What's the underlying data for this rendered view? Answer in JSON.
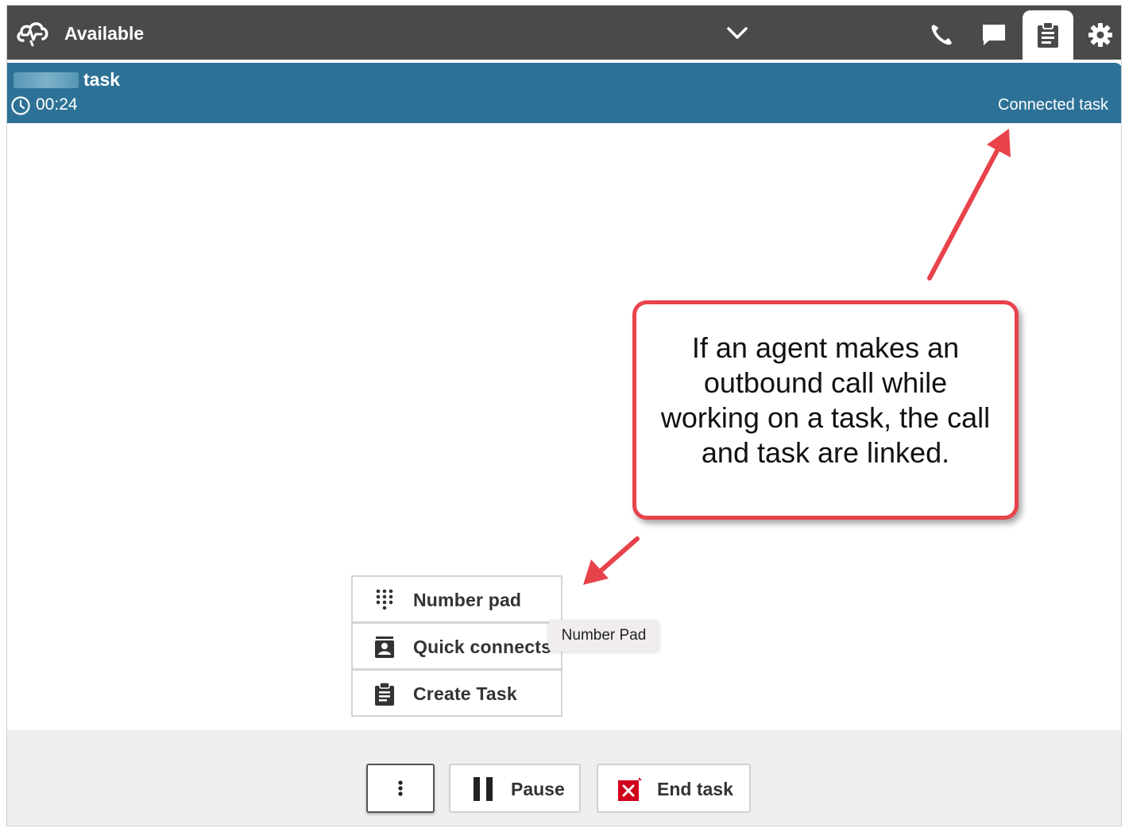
{
  "header": {
    "status": "Available",
    "nav": [
      {
        "name": "phone-icon"
      },
      {
        "name": "chat-icon"
      },
      {
        "name": "task-icon",
        "active": true
      },
      {
        "name": "gear-icon"
      }
    ]
  },
  "banner": {
    "title": "task",
    "timer": "00:24",
    "state": "Connected task",
    "color": "#2d7296"
  },
  "menu": {
    "items": [
      {
        "label": "Number pad",
        "icon": "number-pad-icon"
      },
      {
        "label": "Quick connects",
        "icon": "quick-connects-icon"
      },
      {
        "label": "Create Task",
        "icon": "create-task-icon"
      }
    ],
    "tooltip": "Number Pad"
  },
  "annotation": {
    "text": "If an agent makes an outbound call while working on a task, the call and task are linked.",
    "border_color": "#e8434b"
  },
  "footer": {
    "more_icon": "more-vertical-icon",
    "pause_label": "Pause",
    "end_label": "End task",
    "end_icon_color": "#d0021b"
  }
}
